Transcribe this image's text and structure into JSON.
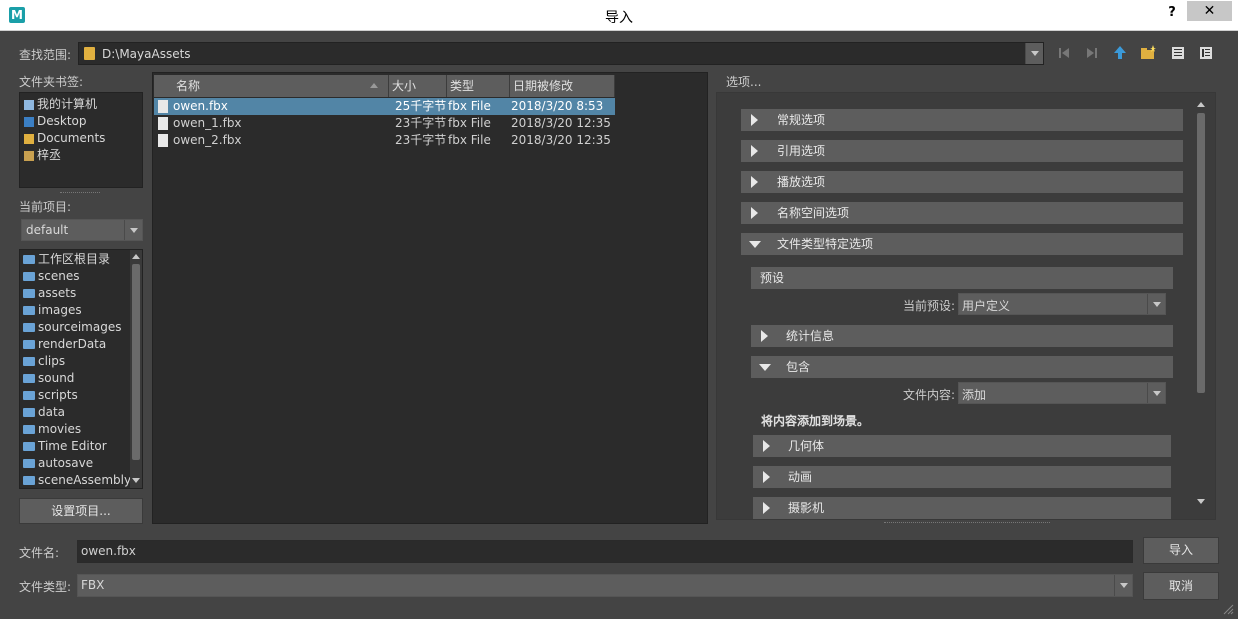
{
  "window": {
    "title": "导入",
    "help": "?",
    "close": "✕"
  },
  "lookin": {
    "label": "查找范围:",
    "path": "D:\\MayaAssets"
  },
  "bookmarks": {
    "label": "文件夹书签:",
    "items": [
      "我的计算机",
      "Desktop",
      "Documents",
      "梓丞"
    ]
  },
  "project": {
    "label": "当前项目:",
    "current": "default",
    "folders": [
      "工作区根目录",
      "scenes",
      "assets",
      "images",
      "sourceimages",
      "renderData",
      "clips",
      "sound",
      "scripts",
      "data",
      "movies",
      "Time Editor",
      "autosave",
      "sceneAssembly"
    ],
    "set_button": "设置项目..."
  },
  "filelist": {
    "columns": [
      "名称",
      "大小",
      "类型",
      "日期被修改"
    ],
    "rows": [
      {
        "name": "owen.fbx",
        "size": "25千字节",
        "type": "fbx File",
        "date": "2018/3/20 8:53"
      },
      {
        "name": "owen_1.fbx",
        "size": "23千字节",
        "type": "fbx File",
        "date": "2018/3/20 12:35"
      },
      {
        "name": "owen_2.fbx",
        "size": "23千字节",
        "type": "fbx File",
        "date": "2018/3/20 12:35"
      }
    ],
    "selected": "owen.fbx"
  },
  "options": {
    "label": "选项...",
    "sections": [
      "常规选项",
      "引用选项",
      "播放选项",
      "名称空间选项",
      "文件类型特定选项"
    ],
    "preset": {
      "header": "预设",
      "label": "当前预设:",
      "value": "用户定义"
    },
    "stats": "统计信息",
    "include": {
      "header": "包含",
      "label": "文件内容:",
      "value": "添加",
      "desc": "将内容添加到场景。"
    },
    "subsections": [
      "几何体",
      "动画",
      "摄影机"
    ]
  },
  "filename": {
    "label": "文件名:",
    "value": "owen.fbx"
  },
  "filetype": {
    "label": "文件类型:",
    "value": "FBX"
  },
  "buttons": {
    "import": "导入",
    "cancel": "取消"
  }
}
